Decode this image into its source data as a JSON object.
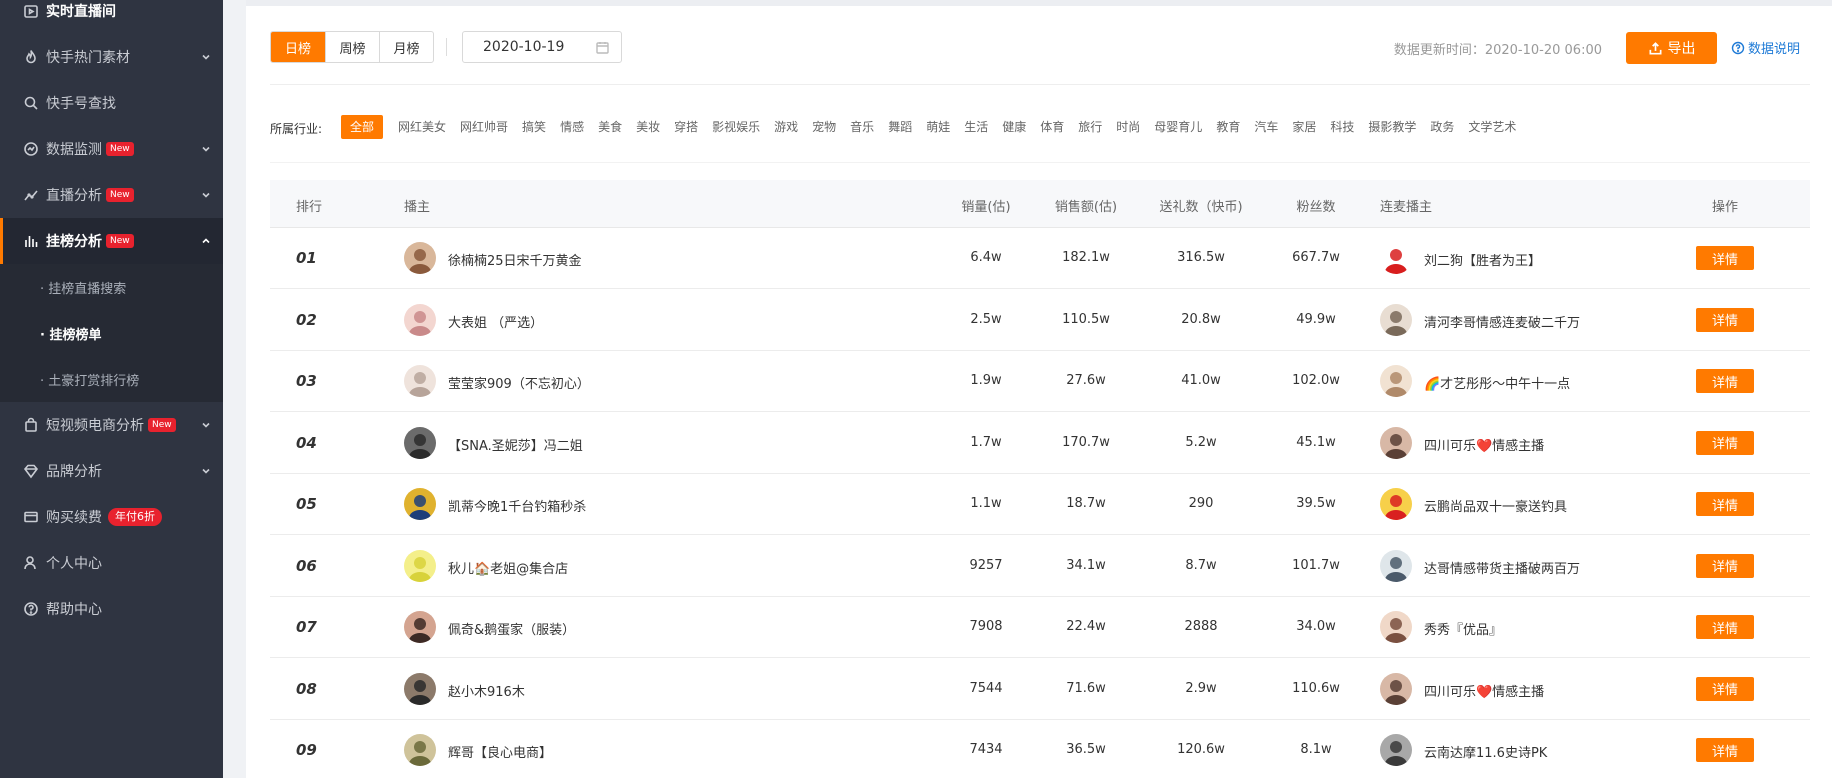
{
  "sidebar": {
    "items": [
      {
        "label": "实时直播间",
        "icon": "live-room-icon"
      },
      {
        "label": "快手热门素材",
        "icon": "fire-icon"
      },
      {
        "label": "快手号查找",
        "icon": "search-icon"
      },
      {
        "label": "数据监测",
        "icon": "monitor-icon",
        "badge": "New"
      },
      {
        "label": "直播分析",
        "icon": "trend-icon",
        "badge": "New"
      },
      {
        "label": "挂榜分析",
        "icon": "bar-chart-icon",
        "badge": "New"
      },
      {
        "label": "短视频电商分析",
        "icon": "shopping-bag-icon",
        "badge": "New"
      },
      {
        "label": "品牌分析",
        "icon": "diamond-icon"
      },
      {
        "label": "购买续费",
        "icon": "card-icon",
        "badge": "年付6折"
      },
      {
        "label": "个人中心",
        "icon": "user-icon"
      },
      {
        "label": "帮助中心",
        "icon": "help-icon"
      }
    ],
    "sub_items": [
      {
        "label": "· 挂榜直播搜索"
      },
      {
        "label": "· 挂榜榜单"
      },
      {
        "label": "· 土豪打赏排行榜"
      }
    ]
  },
  "toolbar": {
    "tabs": [
      "日榜",
      "周榜",
      "月榜"
    ],
    "date": "2020-10-19",
    "update_time": "数据更新时间：2020-10-20 06:00",
    "export_label": "导出",
    "data_desc_label": "数据说明"
  },
  "industry": {
    "label": "所属行业:",
    "options": [
      "全部",
      "网红美女",
      "网红帅哥",
      "搞笑",
      "情感",
      "美食",
      "美妆",
      "穿搭",
      "影视娱乐",
      "游戏",
      "宠物",
      "音乐",
      "舞蹈",
      "萌娃",
      "生活",
      "健康",
      "体育",
      "旅行",
      "时尚",
      "母婴育儿",
      "教育",
      "汽车",
      "家居",
      "科技",
      "摄影教学",
      "政务",
      "文学艺术"
    ]
  },
  "table": {
    "headers": {
      "rank": "排行",
      "streamer": "播主",
      "sales": "销量(估)",
      "revenue": "销售额(估)",
      "gifts": "送礼数（快币)",
      "fans": "粉丝数",
      "connected": "连麦播主",
      "action": "操作"
    },
    "detail_label": "详情",
    "rows": [
      {
        "rank": "01",
        "streamer": "徐楠楠25日宋千万黄金",
        "sales": "6.4w",
        "revenue": "182.1w",
        "gifts": "316.5w",
        "fans": "667.7w",
        "connected": "刘二狗【胜者为王】"
      },
      {
        "rank": "02",
        "streamer": "大表姐 （严选）",
        "sales": "2.5w",
        "revenue": "110.5w",
        "gifts": "20.8w",
        "fans": "49.9w",
        "connected": "清河李哥情感连麦破二千万"
      },
      {
        "rank": "03",
        "streamer": "莹莹家909（不忘初心）",
        "sales": "1.9w",
        "revenue": "27.6w",
        "gifts": "41.0w",
        "fans": "102.0w",
        "connected": "🌈才艺彤彤～中午十一点"
      },
      {
        "rank": "04",
        "streamer": "【SNA.圣妮莎】冯二姐",
        "sales": "1.7w",
        "revenue": "170.7w",
        "gifts": "5.2w",
        "fans": "45.1w",
        "connected": "四川可乐❤️情感主播"
      },
      {
        "rank": "05",
        "streamer": "凯蒂今晚1千台钓箱秒杀",
        "sales": "1.1w",
        "revenue": "18.7w",
        "gifts": "290",
        "fans": "39.5w",
        "connected": "云鹏尚品双十一豪送钓具"
      },
      {
        "rank": "06",
        "streamer": "秋儿🏠老姐@集合店",
        "sales": "9257",
        "revenue": "34.1w",
        "gifts": "8.7w",
        "fans": "101.7w",
        "connected": "达哥情感带货主播破两百万"
      },
      {
        "rank": "07",
        "streamer": "佩奇&鹅蛋家（服装）",
        "sales": "7908",
        "revenue": "22.4w",
        "gifts": "2888",
        "fans": "34.0w",
        "connected": "秀秀『优品』"
      },
      {
        "rank": "08",
        "streamer": "赵小木916木",
        "sales": "7544",
        "revenue": "71.6w",
        "gifts": "2.9w",
        "fans": "110.6w",
        "connected": "四川可乐❤️情感主播"
      },
      {
        "rank": "09",
        "streamer": "辉哥【良心电商】",
        "sales": "7434",
        "revenue": "36.5w",
        "gifts": "120.6w",
        "fans": "8.1w",
        "connected": "云南达摩11.6史诗PK"
      }
    ]
  },
  "colors": {
    "accent": "#ff7a00",
    "sidebar_bg": "#2f3441",
    "badge_red": "#e8222e",
    "link_blue": "#1e7ad6"
  }
}
